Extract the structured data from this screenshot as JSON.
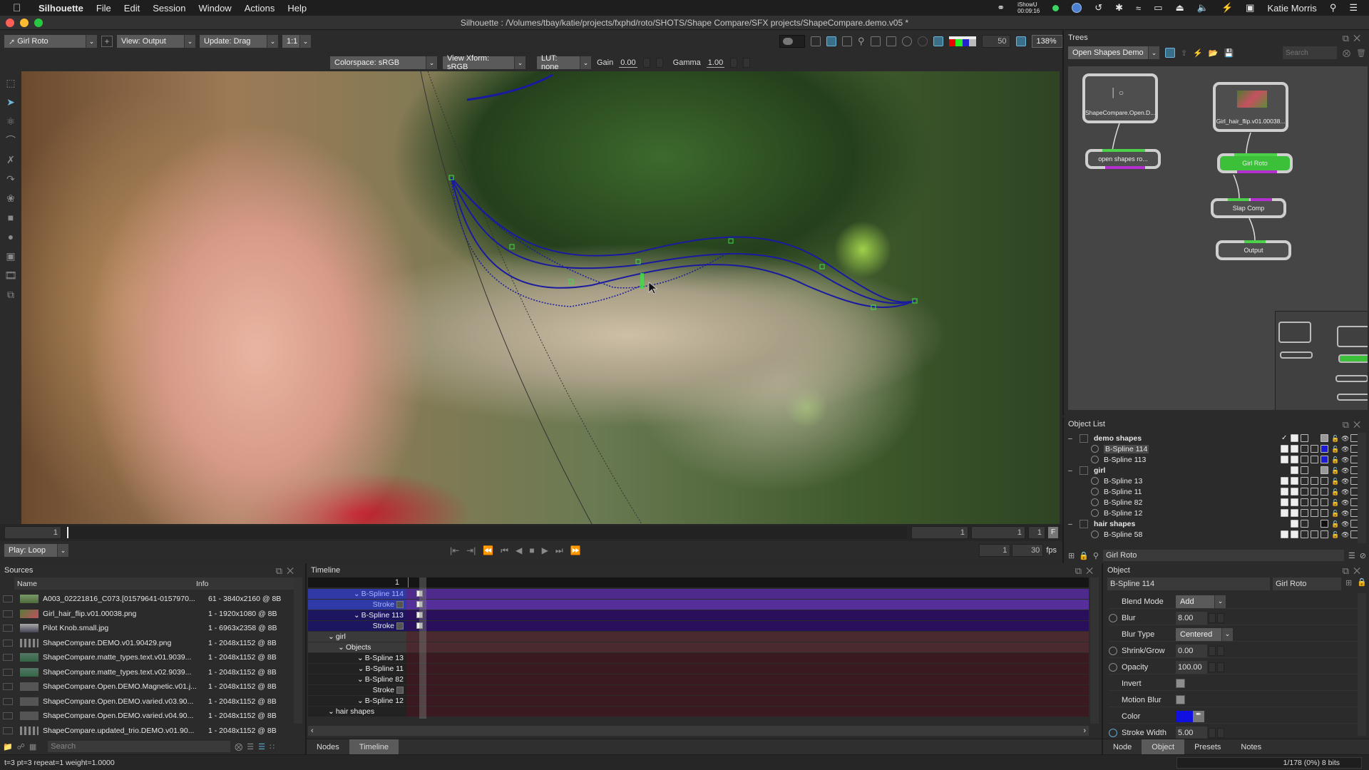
{
  "menubar": {
    "app": "Silhouette",
    "items": [
      "File",
      "Edit",
      "Session",
      "Window",
      "Actions",
      "Help"
    ],
    "ishowu_label": "iShowU",
    "ishowu_time": "00:09:16",
    "user": "Katie Morris"
  },
  "window": {
    "title": "Silhouette : /Volumes/tbay/katie/projects/fxphd/roto/SHOTS/Shape Compare/SFX projects/ShapeCompare.demo.v05 *"
  },
  "toolbar": {
    "node_select": "Girl Roto",
    "view": "View: Output",
    "update": "Update: Drag",
    "ratio": "1:1",
    "exposure_value": "50",
    "zoom": "138%"
  },
  "subbar": {
    "colorspace": "Colorspace: sRGB",
    "view_xform": "View Xform: sRGB",
    "lut": "LUT: none",
    "gain_label": "Gain",
    "gain_value": "0.00",
    "gamma_label": "Gamma",
    "gamma_value": "1.00"
  },
  "tools": [
    "transform-icon",
    "select-icon",
    "reshape-icon",
    "bspline-icon",
    "xspline-icon",
    "bezier-icon",
    "magnetic-icon",
    "rectangle-icon",
    "ellipse-icon",
    "paint-icon",
    "film-edit-icon",
    "layers-icon"
  ],
  "timebar": {
    "current_frame": "1",
    "in_frame": "1",
    "out_frame": "1",
    "end_frame": "1",
    "f_button": "F",
    "play_mode": "Play: Loop",
    "start": "1",
    "fps": "30",
    "fps_label": "fps"
  },
  "trees": {
    "title": "Trees",
    "tree_select": "Open Shapes Demo",
    "search_placeholder": "Search",
    "nodes": [
      {
        "label": "ShapeCompare.Open.D...",
        "type": "source"
      },
      {
        "label": "open shapes ro...",
        "type": "roto"
      },
      {
        "label": "Girl_hair_flip.v01.00038...",
        "type": "source"
      },
      {
        "label": "Girl Roto",
        "type": "roto",
        "active": true
      },
      {
        "label": "Slap Comp",
        "type": "comp"
      },
      {
        "label": "Output",
        "type": "output"
      }
    ]
  },
  "object_list": {
    "title": "Object List",
    "rows": [
      {
        "name": "demo shapes",
        "kind": "group",
        "icon_color": "gray"
      },
      {
        "name": "B-Spline 114",
        "kind": "item",
        "selected": true,
        "icon_color": "blue"
      },
      {
        "name": "B-Spline 113",
        "kind": "item",
        "icon_color": "blue"
      },
      {
        "name": "girl",
        "kind": "group",
        "icon_color": "gray"
      },
      {
        "name": "B-Spline 13",
        "kind": "item",
        "icon_color": "none"
      },
      {
        "name": "B-Spline 11",
        "kind": "item",
        "icon_color": "none"
      },
      {
        "name": "B-Spline 82",
        "kind": "item",
        "icon_color": "none"
      },
      {
        "name": "B-Spline 12",
        "kind": "item",
        "icon_color": "none"
      },
      {
        "name": "hair shapes",
        "kind": "group",
        "icon_color": "black"
      },
      {
        "name": "B-Spline 58",
        "kind": "item",
        "icon_color": "none"
      }
    ],
    "search_value": "Girl Roto"
  },
  "object_panel": {
    "title": "Object",
    "object_name": "B-Spline 114",
    "node_name": "Girl Roto",
    "props": [
      {
        "label": "Blend Mode",
        "type": "select",
        "value": "Add",
        "animatable": false
      },
      {
        "label": "Blur",
        "type": "number",
        "value": "8.00",
        "animatable": true
      },
      {
        "label": "Blur Type",
        "type": "select",
        "value": "Centered",
        "animatable": false
      },
      {
        "label": "Shrink/Grow",
        "type": "number",
        "value": "0.00",
        "animatable": true
      },
      {
        "label": "Opacity",
        "type": "number",
        "value": "100.00",
        "animatable": true
      },
      {
        "label": "Invert",
        "type": "checkbox",
        "value": false,
        "animatable": false
      },
      {
        "label": "Motion Blur",
        "type": "checkbox",
        "value": false,
        "animatable": false
      },
      {
        "label": "Color",
        "type": "color",
        "value": "#1010e0",
        "animatable": false
      },
      {
        "label": "Stroke Width",
        "type": "number",
        "value": "5.00",
        "animatable": true,
        "keyed": true
      }
    ],
    "tabs": [
      "Node",
      "Object",
      "Presets",
      "Notes"
    ],
    "active_tab": "Object"
  },
  "sources": {
    "title": "Sources",
    "columns": [
      "Name",
      "Info"
    ],
    "rows": [
      {
        "name": "A003_02221816_C073.[01579641-0157970...",
        "info": "61 - 3840x2160 @ 8B"
      },
      {
        "name": "Girl_hair_flip.v01.00038.png",
        "info": "1 - 1920x1080 @ 8B"
      },
      {
        "name": "Pilot Knob.small.jpg",
        "info": "1 - 6963x2358 @ 8B"
      },
      {
        "name": "ShapeCompare.DEMO.v01.90429.png",
        "info": "1 - 2048x1152 @ 8B"
      },
      {
        "name": "ShapeCompare.matte_types.text.v01.9039...",
        "info": "1 - 2048x1152 @ 8B"
      },
      {
        "name": "ShapeCompare.matte_types.text.v02.9039...",
        "info": "1 - 2048x1152 @ 8B"
      },
      {
        "name": "ShapeCompare.Open.DEMO.Magnetic.v01.j...",
        "info": "1 - 2048x1152 @ 8B"
      },
      {
        "name": "ShapeCompare.Open.DEMO.varied.v03.90...",
        "info": "1 - 2048x1152 @ 8B"
      },
      {
        "name": "ShapeCompare.Open.DEMO.varied.v04.90...",
        "info": "1 - 2048x1152 @ 8B"
      },
      {
        "name": "ShapeCompare.updated_trio.DEMO.v01.90...",
        "info": "1 - 2048x1152 @ 8B"
      }
    ],
    "search_placeholder": "Search"
  },
  "timeline": {
    "title": "Timeline",
    "frame_label": "1",
    "rows": [
      {
        "label": "B-Spline 114",
        "expand": true,
        "style": "sel1",
        "key": true
      },
      {
        "label": "Stroke",
        "stroke": true,
        "style": "sel1b",
        "key": true
      },
      {
        "label": "B-Spline 113",
        "expand": true,
        "style": "sel2",
        "key": true
      },
      {
        "label": "Stroke",
        "stroke": true,
        "style": "sel2",
        "key": true
      },
      {
        "label": "girl",
        "expand": true,
        "style": "grp",
        "indent": 2
      },
      {
        "label": "Objects",
        "expand": true,
        "style": "grp",
        "indent": 1
      },
      {
        "label": "B-Spline 13",
        "expand": true,
        "style": "red"
      },
      {
        "label": "B-Spline 11",
        "expand": true,
        "style": "red"
      },
      {
        "label": "B-Spline 82",
        "expand": true,
        "style": "red"
      },
      {
        "label": "Stroke",
        "stroke": true,
        "style": "red"
      },
      {
        "label": "B-Spline 12",
        "expand": true,
        "style": "red"
      },
      {
        "label": "hair shapes",
        "expand": true,
        "style": "red",
        "indent": 2
      }
    ],
    "tabs": [
      "Nodes",
      "Timeline"
    ],
    "active_tab": "Timeline"
  },
  "status": {
    "left": "t=3  pt=3  repeat=1  weight=1.0000",
    "right": "1/178 (0%) 8 bits"
  },
  "colors": {
    "spline": "#1a1aa0",
    "point": "#3ee04a",
    "node_active": "#3cc03a"
  }
}
